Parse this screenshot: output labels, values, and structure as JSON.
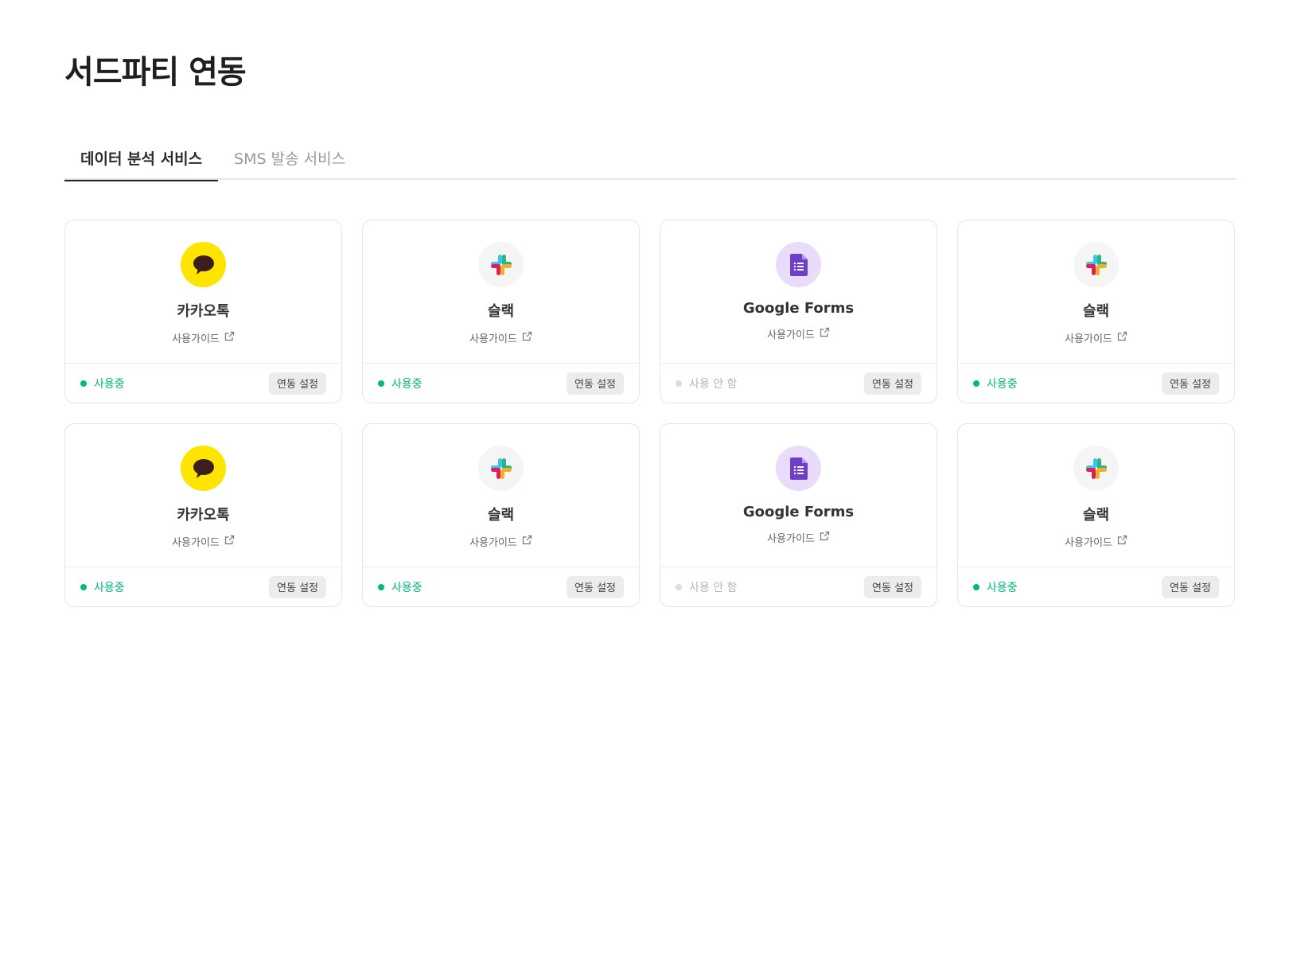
{
  "page": {
    "title": "서드파티 연동"
  },
  "tabs": [
    {
      "label": "데이터 분석 서비스",
      "active": true
    },
    {
      "label": "SMS 발송 서비스",
      "active": false
    }
  ],
  "colors": {
    "active_status": "#00b97a",
    "inactive_status": "#b5b5b5",
    "kakao_yellow": "#fee500",
    "gforms_purple": "#6f3fc8"
  },
  "cards": [
    {
      "service": "카카오톡",
      "icon": "kakaotalk-icon",
      "guide": "사용가이드",
      "status": "사용중",
      "active": true,
      "button": "연동 설정"
    },
    {
      "service": "슬랙",
      "icon": "slack-icon",
      "guide": "사용가이드",
      "status": "사용중",
      "active": true,
      "button": "연동 설정"
    },
    {
      "service": "Google Forms",
      "icon": "google-forms-icon",
      "guide": "사용가이드",
      "status": "사용 안 함",
      "active": false,
      "button": "연동 설정"
    },
    {
      "service": "슬랙",
      "icon": "slack-icon",
      "guide": "사용가이드",
      "status": "사용중",
      "active": true,
      "button": "연동 설정"
    },
    {
      "service": "카카오톡",
      "icon": "kakaotalk-icon",
      "guide": "사용가이드",
      "status": "사용중",
      "active": true,
      "button": "연동 설정"
    },
    {
      "service": "슬랙",
      "icon": "slack-icon",
      "guide": "사용가이드",
      "status": "사용중",
      "active": true,
      "button": "연동 설정"
    },
    {
      "service": "Google Forms",
      "icon": "google-forms-icon",
      "guide": "사용가이드",
      "status": "사용 안 함",
      "active": false,
      "button": "연동 설정"
    },
    {
      "service": "슬랙",
      "icon": "slack-icon",
      "guide": "사용가이드",
      "status": "사용중",
      "active": true,
      "button": "연동 설정"
    }
  ]
}
